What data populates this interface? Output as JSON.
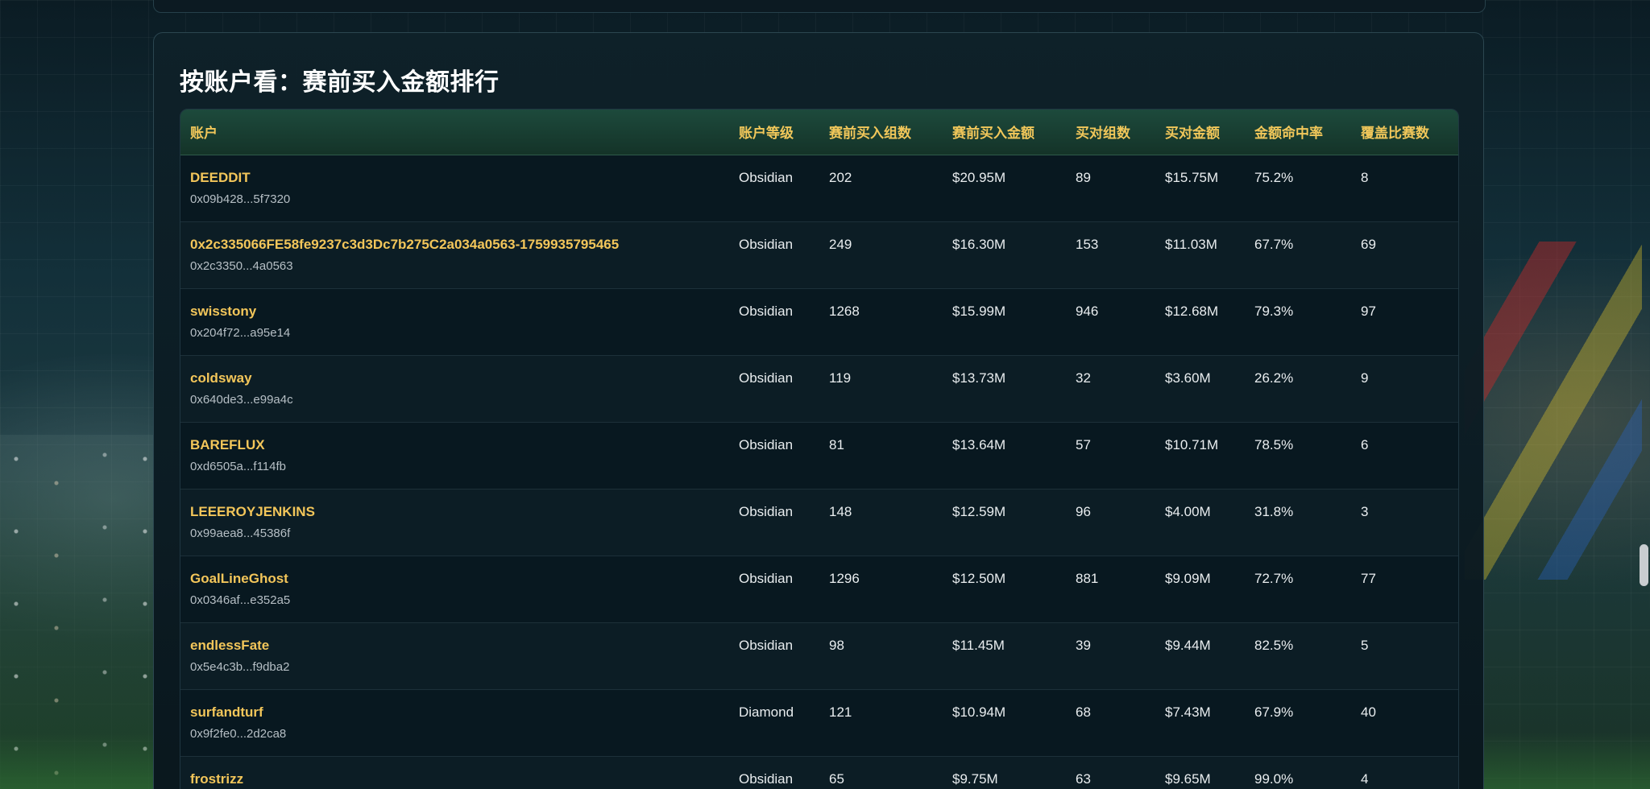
{
  "section": {
    "title": "按账户看：赛前买入金额排行"
  },
  "table": {
    "headers": [
      "账户",
      "账户等级",
      "赛前买入组数",
      "赛前买入金额",
      "买对组数",
      "买对金额",
      "金额命中率",
      "覆盖比赛数"
    ],
    "rows": [
      {
        "name": "DEEDDIT",
        "address": "0x09b428...5f7320",
        "level": "Obsidian",
        "pre_count": "202",
        "pre_amount": "$20.95M",
        "correct_count": "89",
        "correct_amount": "$15.75M",
        "hit_rate": "75.2%",
        "matches": "8"
      },
      {
        "name": "0x2c335066FE58fe9237c3d3Dc7b275C2a034a0563-1759935795465",
        "address": "0x2c3350...4a0563",
        "level": "Obsidian",
        "pre_count": "249",
        "pre_amount": "$16.30M",
        "correct_count": "153",
        "correct_amount": "$11.03M",
        "hit_rate": "67.7%",
        "matches": "69"
      },
      {
        "name": "swisstony",
        "address": "0x204f72...a95e14",
        "level": "Obsidian",
        "pre_count": "1268",
        "pre_amount": "$15.99M",
        "correct_count": "946",
        "correct_amount": "$12.68M",
        "hit_rate": "79.3%",
        "matches": "97"
      },
      {
        "name": "coldsway",
        "address": "0x640de3...e99a4c",
        "level": "Obsidian",
        "pre_count": "119",
        "pre_amount": "$13.73M",
        "correct_count": "32",
        "correct_amount": "$3.60M",
        "hit_rate": "26.2%",
        "matches": "9"
      },
      {
        "name": "BAREFLUX",
        "address": "0xd6505a...f114fb",
        "level": "Obsidian",
        "pre_count": "81",
        "pre_amount": "$13.64M",
        "correct_count": "57",
        "correct_amount": "$10.71M",
        "hit_rate": "78.5%",
        "matches": "6"
      },
      {
        "name": "LEEEROYJENKINS",
        "address": "0x99aea8...45386f",
        "level": "Obsidian",
        "pre_count": "148",
        "pre_amount": "$12.59M",
        "correct_count": "96",
        "correct_amount": "$4.00M",
        "hit_rate": "31.8%",
        "matches": "3"
      },
      {
        "name": "GoalLineGhost",
        "address": "0x0346af...e352a5",
        "level": "Obsidian",
        "pre_count": "1296",
        "pre_amount": "$12.50M",
        "correct_count": "881",
        "correct_amount": "$9.09M",
        "hit_rate": "72.7%",
        "matches": "77"
      },
      {
        "name": "endlessFate",
        "address": "0x5e4c3b...f9dba2",
        "level": "Obsidian",
        "pre_count": "98",
        "pre_amount": "$11.45M",
        "correct_count": "39",
        "correct_amount": "$9.44M",
        "hit_rate": "82.5%",
        "matches": "5"
      },
      {
        "name": "surfandturf",
        "address": "0x9f2fe0...2d2ca8",
        "level": "Diamond",
        "pre_count": "121",
        "pre_amount": "$10.94M",
        "correct_count": "68",
        "correct_amount": "$7.43M",
        "hit_rate": "67.9%",
        "matches": "40"
      },
      {
        "name": "frostrizz",
        "address": "",
        "level": "Obsidian",
        "pre_count": "65",
        "pre_amount": "$9.75M",
        "correct_count": "63",
        "correct_amount": "$9.65M",
        "hit_rate": "99.0%",
        "matches": "4"
      }
    ]
  },
  "colors": {
    "accent": "#f1c75a",
    "panel_bg": "#0c1d25",
    "header_bg": "#1d4a3c"
  }
}
